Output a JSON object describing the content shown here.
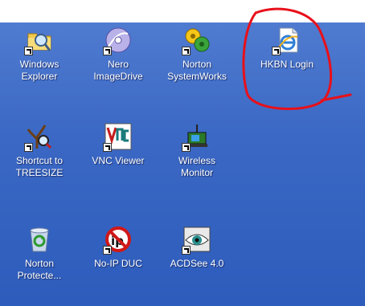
{
  "desktop": {
    "icons": [
      {
        "label": "Windows\nExplorer",
        "icon": "folder-magnifier-icon"
      },
      {
        "label": "Nero\nImageDrive",
        "icon": "disc-icon"
      },
      {
        "label": "Norton\nSystemWorks",
        "icon": "gears-icon"
      },
      {
        "label": "HKBN Login",
        "icon": "internet-explorer-icon"
      },
      {
        "label": "Shortcut to\nTREESIZE",
        "icon": "tree-magnifier-icon"
      },
      {
        "label": "VNC Viewer",
        "icon": "vnc-icon"
      },
      {
        "label": "Wireless\nMonitor",
        "icon": "wireless-monitor-icon"
      },
      {
        "label": "Norton\nProtecte...",
        "icon": "recycle-bin-icon"
      },
      {
        "label": "No-IP DUC",
        "icon": "no-ip-icon"
      },
      {
        "label": "ACDSee 4.0",
        "icon": "acdsee-eye-icon"
      }
    ],
    "annotation_color": "#e8101a"
  }
}
